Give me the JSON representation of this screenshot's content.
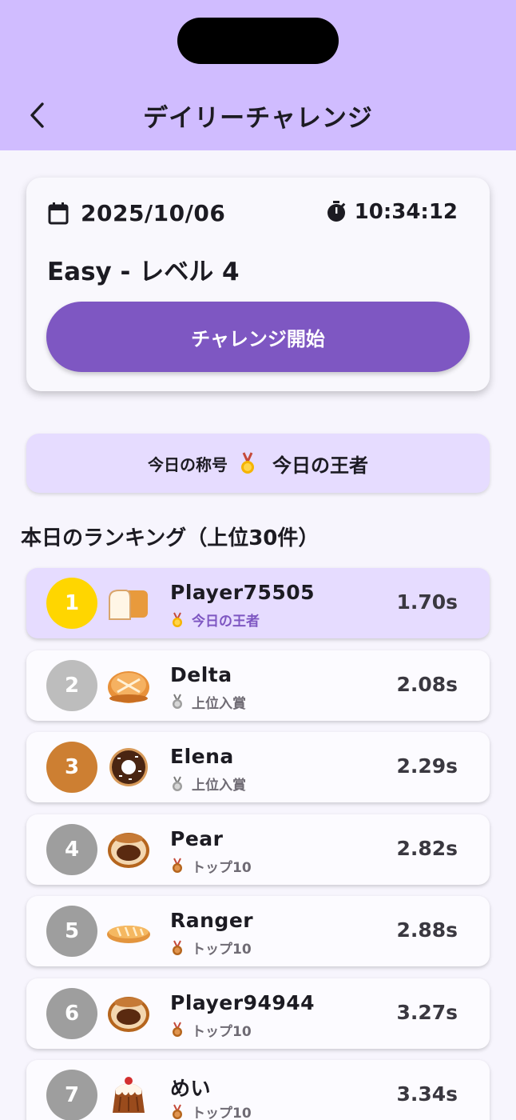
{
  "header": {
    "title": "デイリーチャレンジ"
  },
  "challenge": {
    "date": "2025/10/06",
    "timer": "10:34:12",
    "level": "Easy - レベル 4",
    "start_label": "チャレンジ開始"
  },
  "today_title": {
    "label": "今日の称号",
    "value": "今日の王者"
  },
  "ranking": {
    "heading": "本日のランキング（上位30件）",
    "rows": [
      {
        "rank": "1",
        "name": "Player75505",
        "badge": "今日の王者",
        "time": "1.70s",
        "bread": "bread-loaf-icon",
        "medal": "gold"
      },
      {
        "rank": "2",
        "name": "Delta",
        "badge": "上位入賞",
        "time": "2.08s",
        "bread": "bun-icon",
        "medal": "silver"
      },
      {
        "rank": "3",
        "name": "Elena",
        "badge": "上位入賞",
        "time": "2.29s",
        "bread": "donut-icon",
        "medal": "silver"
      },
      {
        "rank": "4",
        "name": "Pear",
        "badge": "トップ10",
        "time": "2.82s",
        "bread": "chocolate-bun-icon",
        "medal": "bronze"
      },
      {
        "rank": "5",
        "name": "Ranger",
        "badge": "トップ10",
        "time": "2.88s",
        "bread": "baguette-icon",
        "medal": "bronze"
      },
      {
        "rank": "6",
        "name": "Player94944",
        "badge": "トップ10",
        "time": "3.27s",
        "bread": "chocolate-bun-icon",
        "medal": "bronze"
      },
      {
        "rank": "7",
        "name": "めい",
        "badge": "トップ10",
        "time": "3.34s",
        "bread": "pudding-cake-icon",
        "medal": "bronze"
      }
    ]
  },
  "colors": {
    "header_bg": "#d0bcff",
    "accent": "#7e57c2",
    "rank_gold": "#ffd600",
    "rank_silver": "#bdbdbd",
    "rank_bronze": "#cd7f32",
    "rank_default": "#9e9e9e"
  }
}
